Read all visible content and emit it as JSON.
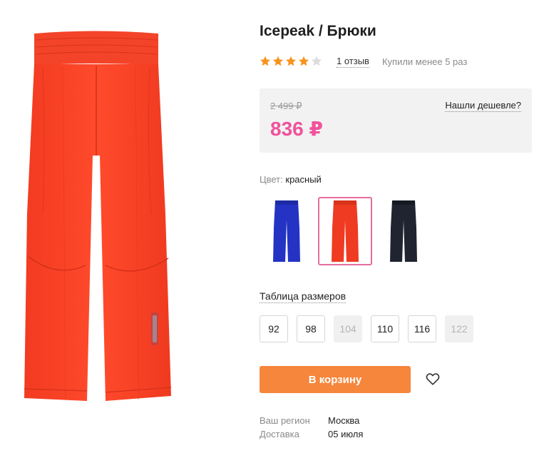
{
  "product": {
    "title": "Icepeak / Брюки",
    "image_icon": "orange-pants-image",
    "rating_stars": 4,
    "rating_max": 5,
    "reviews_text": "1 отзыв",
    "bought_text": "Купили менее 5 раз"
  },
  "price": {
    "old": "2 499 ₽",
    "current": "836 ₽",
    "cheaper_link": "Нашли дешевле?"
  },
  "color": {
    "label": "Цвет:",
    "selected": "красный",
    "options": [
      {
        "name": "blue",
        "hex": "#2433c4"
      },
      {
        "name": "red",
        "hex": "#ef3b22"
      },
      {
        "name": "black",
        "hex": "#1f2430"
      }
    ]
  },
  "sizes": {
    "table_link": "Таблица размеров",
    "items": [
      {
        "label": "92",
        "available": true
      },
      {
        "label": "98",
        "available": true
      },
      {
        "label": "104",
        "available": false
      },
      {
        "label": "110",
        "available": true
      },
      {
        "label": "116",
        "available": true
      },
      {
        "label": "122",
        "available": false
      }
    ]
  },
  "cart": {
    "button_label": "В корзину",
    "wishlist_icon": "heart-icon"
  },
  "delivery": {
    "region_label": "Ваш регион",
    "region_value": "Москва",
    "delivery_label": "Доставка",
    "delivery_value": "05 июля"
  },
  "colors": {
    "accent_orange": "#f6863c",
    "price_pink": "#f0529c",
    "star": "#f7931e",
    "star_empty": "#dcdcdc",
    "selected_border": "#e56d9f"
  }
}
